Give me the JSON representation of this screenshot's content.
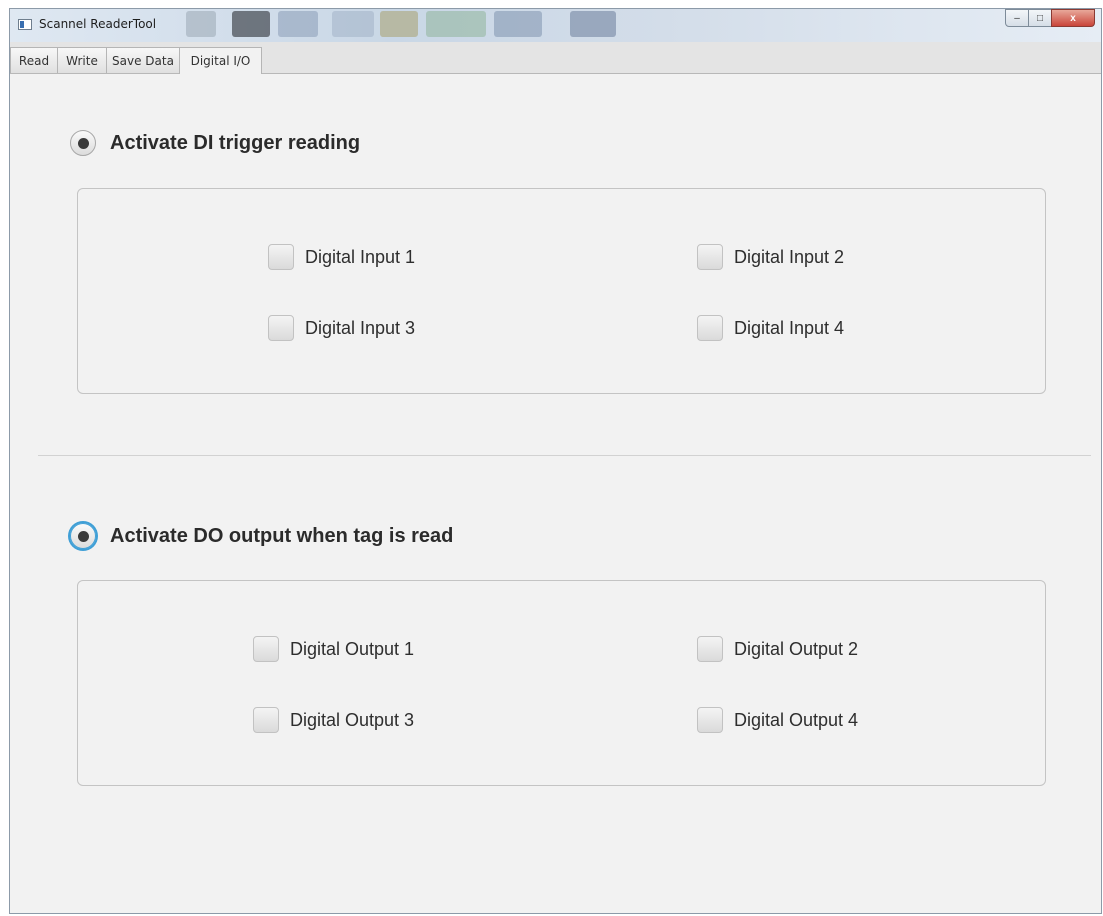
{
  "window": {
    "title": "Scannel ReaderTool",
    "caption": {
      "minimize": "–",
      "maximize": "□",
      "close": "x"
    }
  },
  "tabs": [
    {
      "label": "Read",
      "active": false
    },
    {
      "label": "Write",
      "active": false
    },
    {
      "label": "Save Data",
      "active": false
    },
    {
      "label": "Digital I/O",
      "active": true
    }
  ],
  "trigger_section": {
    "label": "Activate DI trigger reading",
    "selected": true,
    "inputs": [
      {
        "label": "Digital Input 1",
        "checked": false
      },
      {
        "label": "Digital Input 2",
        "checked": false
      },
      {
        "label": "Digital Input 3",
        "checked": false
      },
      {
        "label": "Digital Input 4",
        "checked": false
      }
    ]
  },
  "output_section": {
    "label": "Activate DO output when tag is read",
    "selected": true,
    "focused": true,
    "outputs": [
      {
        "label": "Digital Output 1",
        "checked": false
      },
      {
        "label": "Digital Output 2",
        "checked": false
      },
      {
        "label": "Digital Output 3",
        "checked": false
      },
      {
        "label": "Digital Output 4",
        "checked": false
      }
    ]
  },
  "colors": {
    "background": "#f2f2f2",
    "focus_ring": "#3f9fd6",
    "text": "#2b2b2b"
  }
}
